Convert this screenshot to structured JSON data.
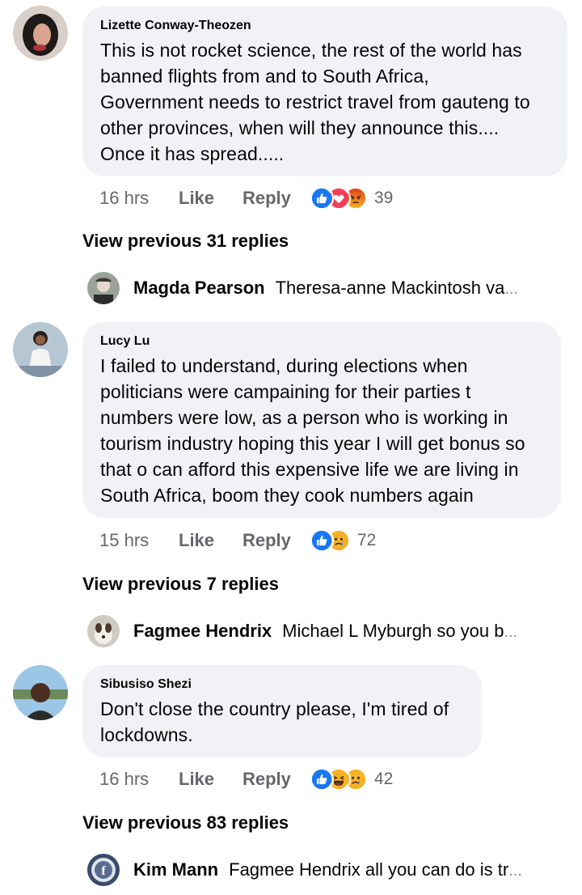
{
  "comments": [
    {
      "author": "Lizette Conway-Theozen",
      "lines": [
        "This is not rocket science, the rest of the world has",
        "banned flights from and to South Africa,",
        "Government needs to restrict travel from gauteng to",
        "other provinces, when will they announce this....",
        "Once it has spread....."
      ],
      "time": "16 hrs",
      "like_label": "Like",
      "reply_label": "Reply",
      "reactions": [
        "like-icon",
        "love-icon",
        "angry-icon"
      ],
      "reaction_count": "39",
      "view_previous": "View previous 31 replies",
      "latest_reply": {
        "name": "Magda Pearson",
        "text": "Theresa-anne Mackintosh va",
        "ellipsis": "..."
      }
    },
    {
      "author": "Lucy Lu",
      "lines": [
        "I failed to understand, during elections when",
        "politicians were campaining for their parties t",
        "numbers were low, as a person who is working in",
        "tourism industry hoping this year I will get bonus so",
        "that o can afford this expensive life we are living in",
        "South Africa, boom they cook numbers again"
      ],
      "time": "15 hrs",
      "like_label": "Like",
      "reply_label": "Reply",
      "reactions": [
        "like-icon",
        "sad-icon"
      ],
      "reaction_count": "72",
      "view_previous": "View previous 7 replies",
      "latest_reply": {
        "name": "Fagmee Hendrix",
        "text": "Michael L Myburgh so you b",
        "ellipsis": "..."
      }
    },
    {
      "author": "Sibusiso Shezi",
      "lines": [
        "Don't close the country please, I'm tired of",
        "lockdowns."
      ],
      "time": "16 hrs",
      "like_label": "Like",
      "reply_label": "Reply",
      "reactions": [
        "like-icon",
        "haha-icon",
        "sad-icon"
      ],
      "reaction_count": "42",
      "view_previous": "View previous 83 replies",
      "latest_reply": {
        "name": "Kim Mann",
        "text": "Fagmee Hendrix all you can do is tr",
        "ellipsis": "..."
      }
    }
  ],
  "colors": {
    "like": "#1877f2",
    "love": "#f33e58",
    "angry": "#e9710f",
    "yellow": "#f7b125",
    "bubble": "#f0f2f5",
    "secondary_text": "#65676b"
  }
}
